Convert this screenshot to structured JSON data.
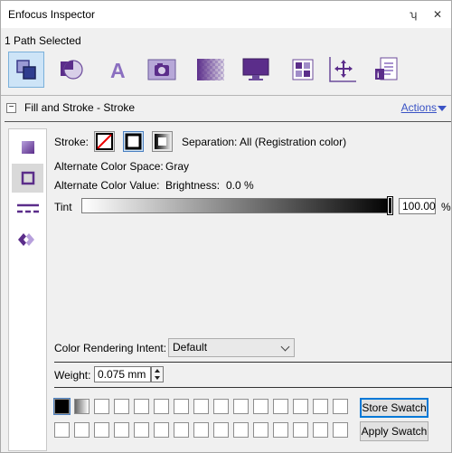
{
  "window": {
    "title": "Enfocus Inspector",
    "pin_glyph": "ʮ",
    "close_glyph": "✕"
  },
  "status": {
    "path_selected": "1 Path Selected"
  },
  "toolbar": {
    "icons": [
      "selection-icon",
      "pie-shape-icon",
      "text-a-icon",
      "camera-image-icon",
      "transparency-checker-icon",
      "monitor-icon",
      "grid-layout-icon",
      "position-axes-icon",
      "document-properties-icon"
    ]
  },
  "section": {
    "title": "Fill and Stroke - Stroke",
    "actions_label": "Actions",
    "collapse_glyph": "−"
  },
  "left_panel": {
    "items": [
      "fill-icon",
      "stroke-icon",
      "dashes-icon",
      "overprint-icon"
    ]
  },
  "stroke": {
    "label": "Stroke:",
    "separation": "Separation: All (Registration color)",
    "alt_space_label": "Alternate Color Space:",
    "alt_space_value": "Gray",
    "alt_value_label": "Alternate Color Value:",
    "alt_value_text": "Brightness:",
    "alt_value_pct": "0.0 %",
    "tint_label": "Tint",
    "tint_value": "100.00",
    "tint_unit": "%",
    "tint_level": 1.0
  },
  "rendering": {
    "label": "Color Rendering Intent:",
    "value": "Default"
  },
  "weight": {
    "label": "Weight:",
    "value": "0.075 mm"
  },
  "swatches": {
    "store_label": "Store Swatch",
    "apply_label": "Apply Swatch"
  },
  "colors": {
    "accent": "#7b3fa6",
    "link": "#3a53c5",
    "selected_bg": "#cde4f7"
  }
}
